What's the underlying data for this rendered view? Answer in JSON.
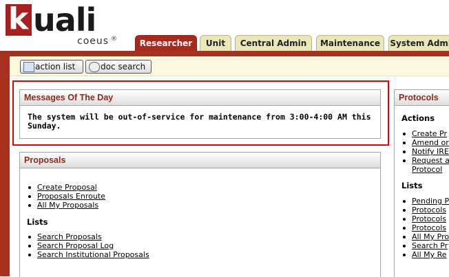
{
  "app": {
    "logo_word": "uali",
    "logo_k": "k",
    "logo_sub": "coeus",
    "logo_reg": "®"
  },
  "tabs": [
    {
      "label": "Researcher",
      "active": true
    },
    {
      "label": "Unit",
      "active": false
    },
    {
      "label": "Central Admin",
      "active": false
    },
    {
      "label": "Maintenance",
      "active": false
    },
    {
      "label": "System Admin",
      "active": false
    }
  ],
  "toolbar": {
    "action_list_label": "action list",
    "action_list_icon": "list-icon",
    "doc_search_label": "doc search",
    "doc_search_icon": "search-icon"
  },
  "messages": {
    "title": "Messages Of The Day",
    "text": "The system will be out-of-service for maintenance from 3:00-4:00 AM this Sunday."
  },
  "proposals": {
    "title": "Proposals",
    "actions": [
      "Create Proposal",
      "Proposals Enroute",
      "All My Proposals"
    ],
    "lists_label": "Lists",
    "lists": [
      "Search Proposals",
      "Search Proposal Log",
      "Search Institutional Proposals"
    ]
  },
  "protocols": {
    "title": "Protocols",
    "actions_label": "Actions",
    "actions": [
      "Create Pr",
      "Amend or",
      "Notify IRE",
      "Request a",
      "Protocol"
    ],
    "lists_label": "Lists",
    "lists": [
      "Pending P",
      "Protocols",
      "Protocols",
      "Protocols",
      "All My Pro",
      "Search Pr",
      "All My Re"
    ]
  },
  "colors": {
    "brand_red": "#a8301e",
    "tab_bg": "#ebe7b8",
    "section_title": "#8c2a1a",
    "highlight": "#e00000"
  }
}
